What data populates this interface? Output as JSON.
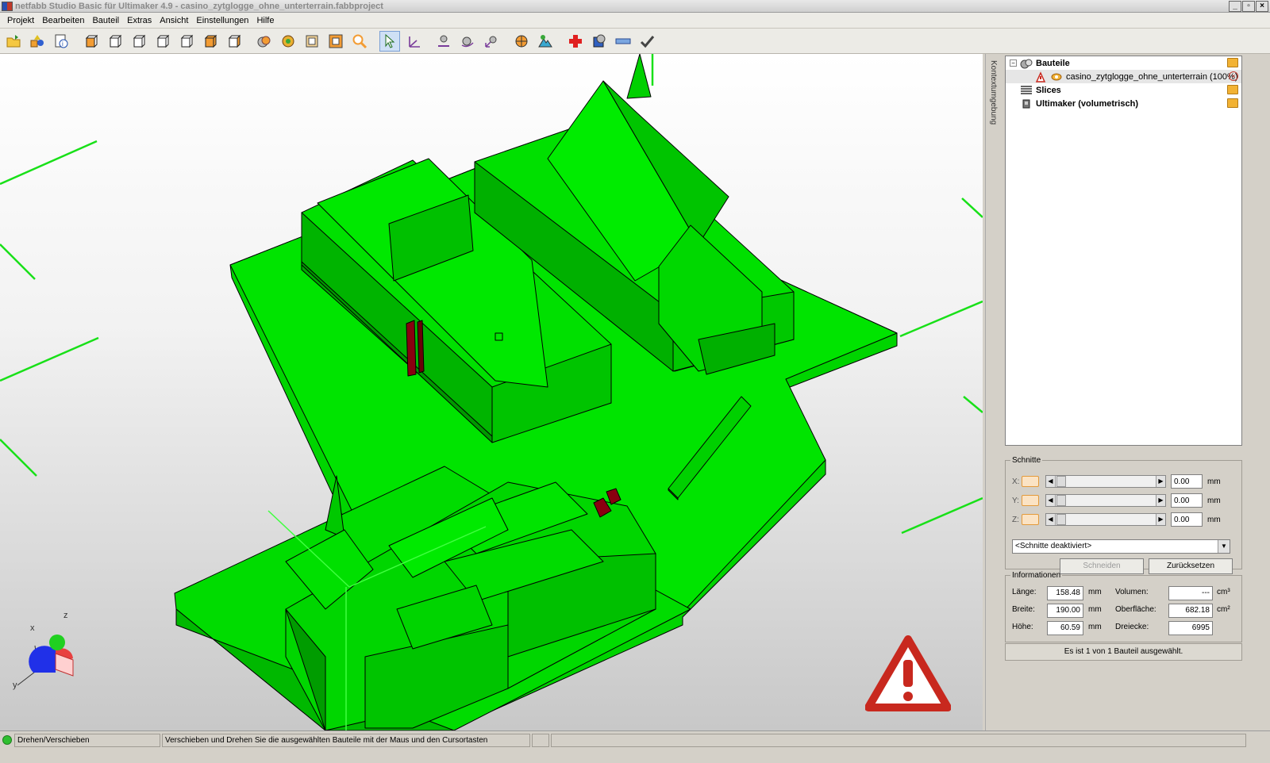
{
  "window": {
    "title": "netfabb Studio Basic für Ultimaker 4.9 - casino_zytglogge_ohne_unterterrain.fabbproject",
    "minimize": "_",
    "maximize": "▫",
    "close": "×"
  },
  "menu": [
    "Projekt",
    "Bearbeiten",
    "Bauteil",
    "Extras",
    "Ansicht",
    "Einstellungen",
    "Hilfe"
  ],
  "context_tab": "Kontextumgebung",
  "tree": {
    "root_label": "Bauteile",
    "part_label": "casino_zytglogge_ohne_unterterrain (100%)",
    "slices_label": "Slices",
    "machine_label": "Ultimaker (volumetrisch)",
    "expander": "−"
  },
  "cuts": {
    "legend": "Schnitte",
    "rows": [
      {
        "axis": "X:",
        "value": "0.00",
        "unit": "mm"
      },
      {
        "axis": "Y:",
        "value": "0.00",
        "unit": "mm"
      },
      {
        "axis": "Z:",
        "value": "0.00",
        "unit": "mm"
      }
    ],
    "select_value": "<Schnitte deaktiviert>",
    "cut_button": "Schneiden",
    "reset_button": "Zurücksetzen"
  },
  "info": {
    "legend": "Informationen",
    "length_label": "Länge:",
    "length_value": "158.48",
    "length_unit": "mm",
    "width_label": "Breite:",
    "width_value": "190.00",
    "width_unit": "mm",
    "height_label": "Höhe:",
    "height_value": "60.59",
    "height_unit": "mm",
    "volume_label": "Volumen:",
    "volume_value": "---",
    "volume_unit": "cm³",
    "surface_label": "Oberfläche:",
    "surface_value": "682.18",
    "surface_unit": "cm²",
    "triangles_label": "Dreiecke:",
    "triangles_value": "6995"
  },
  "selection_info": "Es ist 1 von 1 Bauteil ausgewählt.",
  "axes": {
    "x": "x",
    "y": "y",
    "z": "z"
  },
  "status": {
    "mode": "Drehen/Verschieben",
    "hint": "Verschieben und Drehen Sie die ausgewählten Bauteile mit der Maus und den Cursortasten"
  },
  "colors": {
    "model": "#00e000",
    "model_dark": "#00a800",
    "warning": "#c8281e",
    "accent_orange": "#f2b233"
  }
}
